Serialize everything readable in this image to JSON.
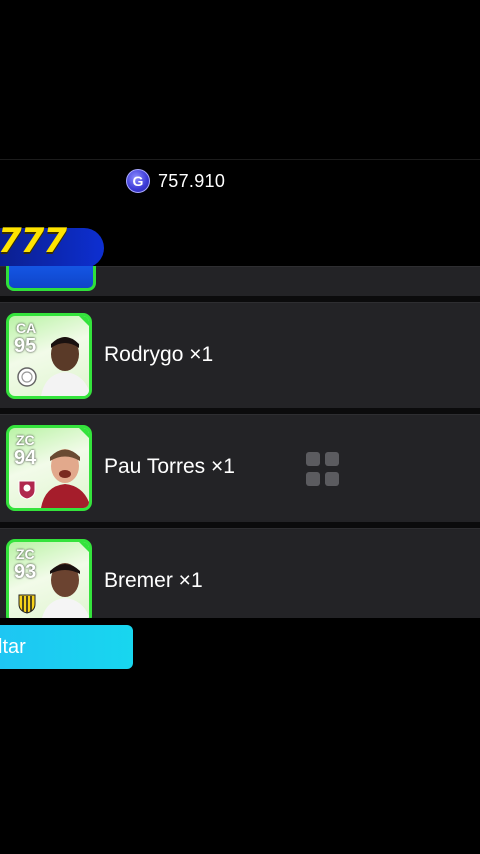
{
  "header": {
    "currency_symbol": "G",
    "currency_amount": "757.910"
  },
  "promo": {
    "text": "777"
  },
  "players": [
    {
      "position": "CA",
      "rating": "95",
      "name": "Rodrygo ×1"
    },
    {
      "position": "ZC",
      "rating": "94",
      "name": "Pau Torres ×1"
    },
    {
      "position": "ZC",
      "rating": "93",
      "name": "Bremer ×1"
    }
  ],
  "footer": {
    "back_label": "ltar"
  },
  "colors": {
    "card_border": "#34e33c",
    "button": "#1ec6f3",
    "promo_text": "#ffe400",
    "promo_bg": "#0d2fd1"
  },
  "icons": {
    "currency": "gp-coin-icon",
    "grid": "grid-menu-icon"
  }
}
